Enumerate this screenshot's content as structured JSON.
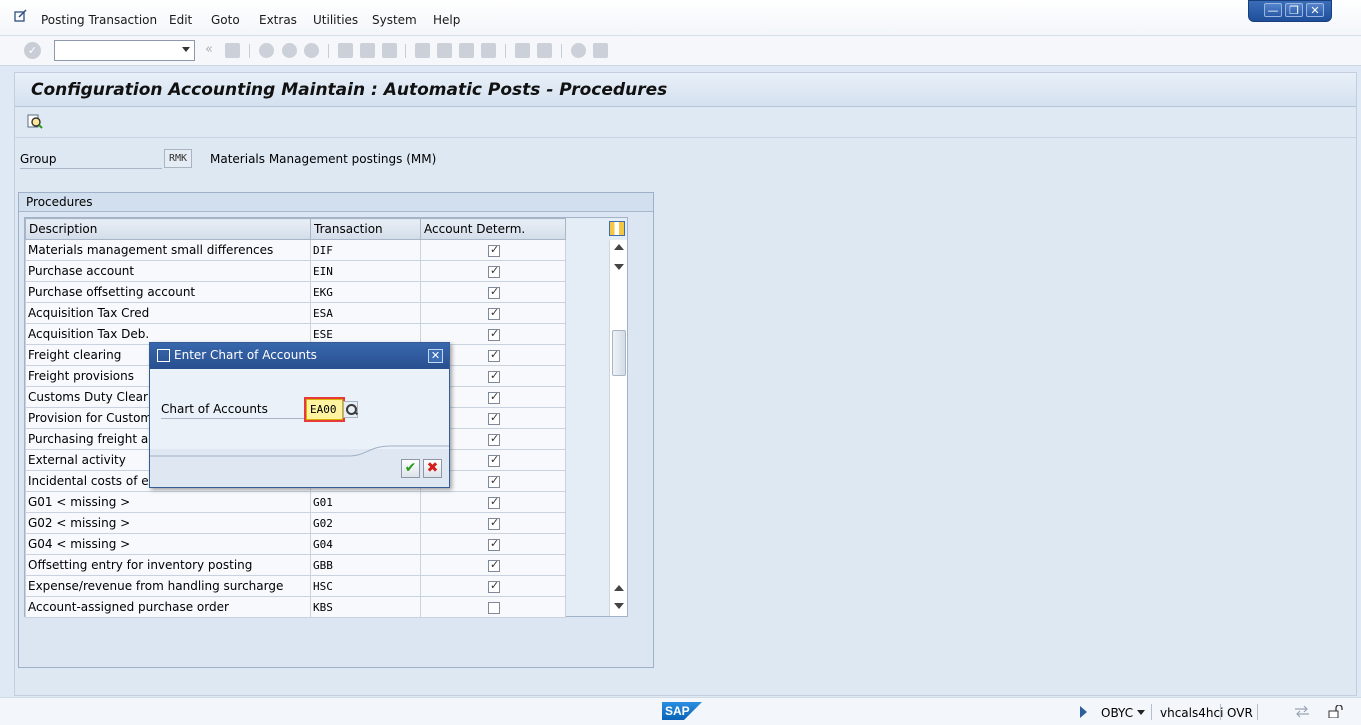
{
  "menubar": {
    "items": [
      {
        "label": "Posting Transaction"
      },
      {
        "label": "Edit"
      },
      {
        "label": "Goto"
      },
      {
        "label": "Extras"
      },
      {
        "label": "Utilities"
      },
      {
        "label": "System"
      },
      {
        "label": "Help"
      }
    ]
  },
  "window_controls": {
    "minimize": "—",
    "restore": "❐",
    "close": "✕"
  },
  "toolbar": {
    "command_field_value": ""
  },
  "screen": {
    "title": "Configuration Accounting Maintain : Automatic Posts - Procedures"
  },
  "group": {
    "label": "Group",
    "value": "RMK",
    "description": "Materials Management postings (MM)"
  },
  "procedures": {
    "frame_title": "Procedures",
    "columns": [
      "Description",
      "Transaction",
      "Account Determ."
    ],
    "rows": [
      {
        "description": "Materials management small differences",
        "transaction": "DIF",
        "checked": true
      },
      {
        "description": "Purchase account",
        "transaction": "EIN",
        "checked": true
      },
      {
        "description": "Purchase offsetting account",
        "transaction": "EKG",
        "checked": true
      },
      {
        "description": "Acquisition Tax Cred",
        "transaction": "ESA",
        "checked": true
      },
      {
        "description": "Acquisition Tax Deb.",
        "transaction": "ESE",
        "checked": true
      },
      {
        "description": "Freight clearing",
        "transaction": "",
        "checked": true
      },
      {
        "description": "Freight provisions",
        "transaction": "",
        "checked": true
      },
      {
        "description": "Customs Duty Clearing",
        "transaction": "",
        "checked": true
      },
      {
        "description": "Provision for Customs D",
        "transaction": "",
        "checked": true
      },
      {
        "description": "Purchasing freight acco",
        "transaction": "",
        "checked": true
      },
      {
        "description": "External activity",
        "transaction": "",
        "checked": true
      },
      {
        "description": "Incidental costs of exte",
        "transaction": "",
        "checked": true
      },
      {
        "description": "G01 < missing >",
        "transaction": "G01",
        "checked": true
      },
      {
        "description": "G02 < missing >",
        "transaction": "G02",
        "checked": true
      },
      {
        "description": "G04 < missing >",
        "transaction": "G04",
        "checked": true
      },
      {
        "description": "Offsetting entry for inventory posting",
        "transaction": "GBB",
        "checked": true
      },
      {
        "description": "Expense/revenue from handling surcharge",
        "transaction": "HSC",
        "checked": true
      },
      {
        "description": "Account-assigned purchase order",
        "transaction": "KBS",
        "checked": false
      }
    ]
  },
  "dialog": {
    "title": "Enter Chart of Accounts",
    "field_label": "Chart of Accounts",
    "field_value": "EA00",
    "close_label": "✕",
    "ok_label": "✔",
    "cancel_label": "✖"
  },
  "statusbar": {
    "logo": "SAP",
    "transaction": "OBYC",
    "system": "vhcals4hci",
    "mode": "OVR"
  },
  "colors": {
    "dialog_header": "#2f5c9e",
    "input_highlight": "#fff3a0",
    "ok_green": "#2a9c16",
    "cancel_red": "#d2211a"
  }
}
